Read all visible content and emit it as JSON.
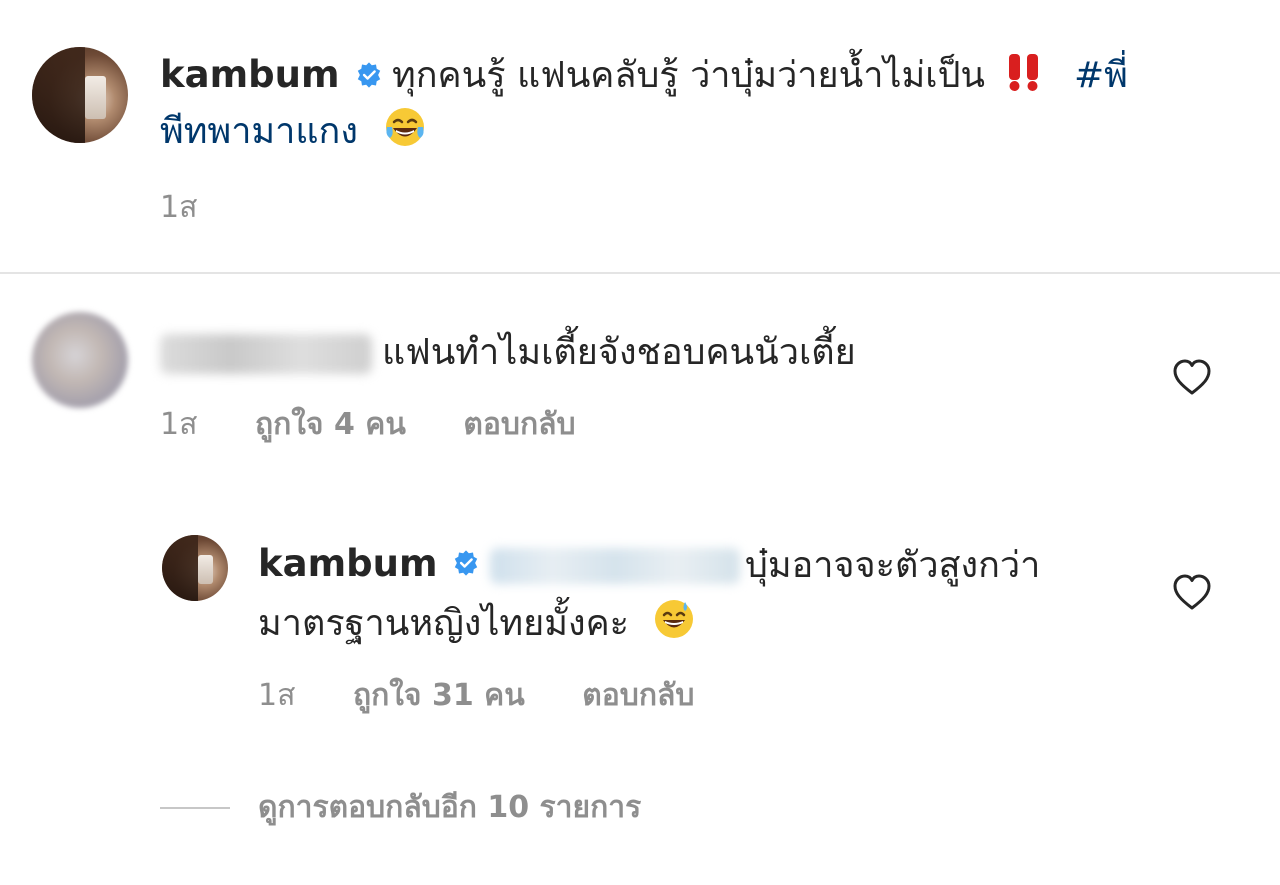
{
  "post": {
    "username": "kambum",
    "verified_icon": "verified-badge-icon",
    "caption_line1": "ทุกคนรู้ แฟนคลับรู้ ว่าบุ๋มว่ายน้ำไม่เป็น",
    "caption_emoji": "‼️",
    "hashtag_part1": "#พี่",
    "hashtag_part2": "พีทพามาแกง",
    "caption_end_emoji": "😂",
    "time": "1ส"
  },
  "comment": {
    "username_blurred": "ddekhraaa",
    "text": "แฟนทำไมเตี้ยจังชอบคนนัวเตี้ย",
    "time": "1ส",
    "likes": "ถูกใจ 4 คน",
    "reply_label": "ตอบกลับ"
  },
  "reply": {
    "username": "kambum",
    "mention_blurred": "@ddekhraaa",
    "text_line1": "บุ๋มอาจจะตัวสูงกว่า",
    "text_line2": "มาตรฐานหญิงไทยมั้งคะ",
    "emoji": "😅",
    "time": "1ส",
    "likes": "ถูกใจ 31 คน",
    "reply_label": "ตอบกลับ"
  },
  "view_more": {
    "label": "ดูการตอบกลับอีก 10 รายการ"
  },
  "colors": {
    "hashtag": "#00376b",
    "verified": "#3897f0",
    "exclaim": "#d91f1f",
    "meta": "#8e8e8e"
  }
}
